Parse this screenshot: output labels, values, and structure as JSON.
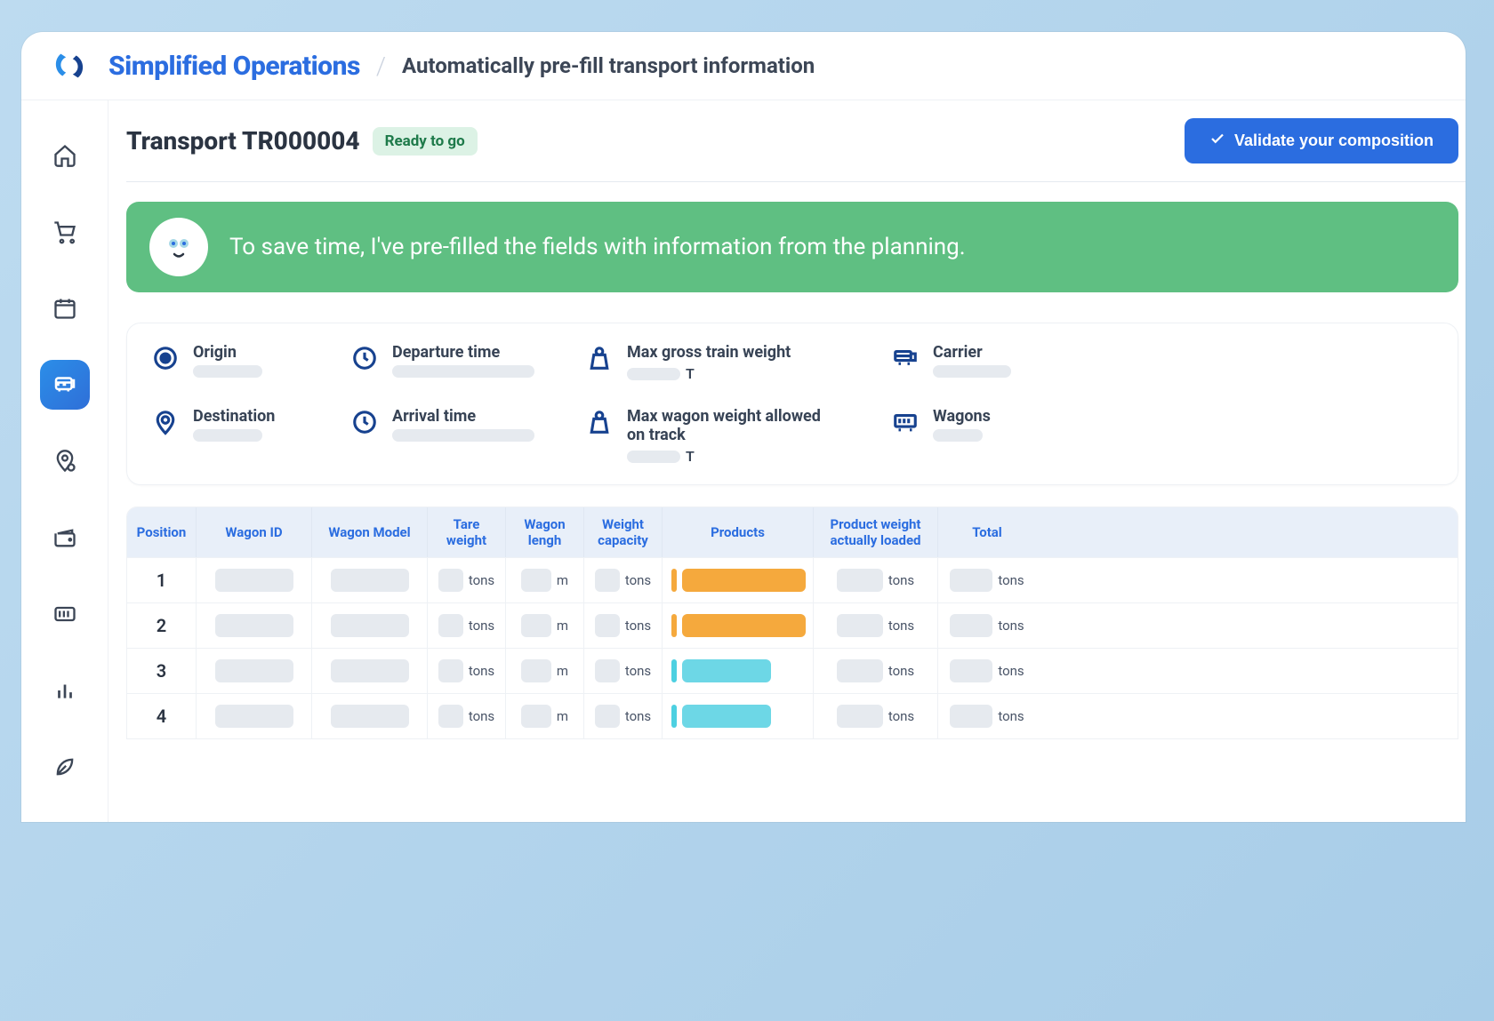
{
  "brand": {
    "title": "Simplified Operations",
    "subtitle": "Automatically pre-fill transport information"
  },
  "page": {
    "title": "Transport TR000004",
    "status": "Ready to go"
  },
  "actions": {
    "validate": "Validate your composition"
  },
  "banner": {
    "text": "To save time, I've pre-filled the fields with information from the planning."
  },
  "info": {
    "origin": {
      "label": "Origin"
    },
    "departure": {
      "label": "Departure time"
    },
    "maxGross": {
      "label": "Max gross train weight",
      "unit": "T"
    },
    "carrier": {
      "label": "Carrier"
    },
    "destination": {
      "label": "Destination"
    },
    "arrival": {
      "label": "Arrival time"
    },
    "maxWagon": {
      "label": "Max wagon weight allowed on track",
      "unit": "T"
    },
    "wagons": {
      "label": "Wagons"
    }
  },
  "table": {
    "headers": {
      "position": "Position",
      "wagonId": "Wagon ID",
      "wagonModel": "Wagon Model",
      "tare": "Tare weight",
      "length": "Wagon lengh",
      "capacity": "Weight capacity",
      "products": "Products",
      "loaded": "Product weight actually loaded",
      "total": "Total"
    },
    "units": {
      "tons": "tons",
      "m": "m"
    },
    "rows": [
      {
        "pos": "1",
        "productColor": "orange",
        "barFull": true
      },
      {
        "pos": "2",
        "productColor": "orange",
        "barFull": true
      },
      {
        "pos": "3",
        "productColor": "cyan",
        "barFull": false
      },
      {
        "pos": "4",
        "productColor": "cyan",
        "barFull": false
      }
    ]
  },
  "nav": [
    {
      "name": "home",
      "active": false
    },
    {
      "name": "cart",
      "active": false
    },
    {
      "name": "calendar",
      "active": false
    },
    {
      "name": "train",
      "active": true
    },
    {
      "name": "location",
      "active": false
    },
    {
      "name": "wallet",
      "active": false
    },
    {
      "name": "container",
      "active": false
    },
    {
      "name": "chart",
      "active": false
    },
    {
      "name": "leaf",
      "active": false
    }
  ]
}
